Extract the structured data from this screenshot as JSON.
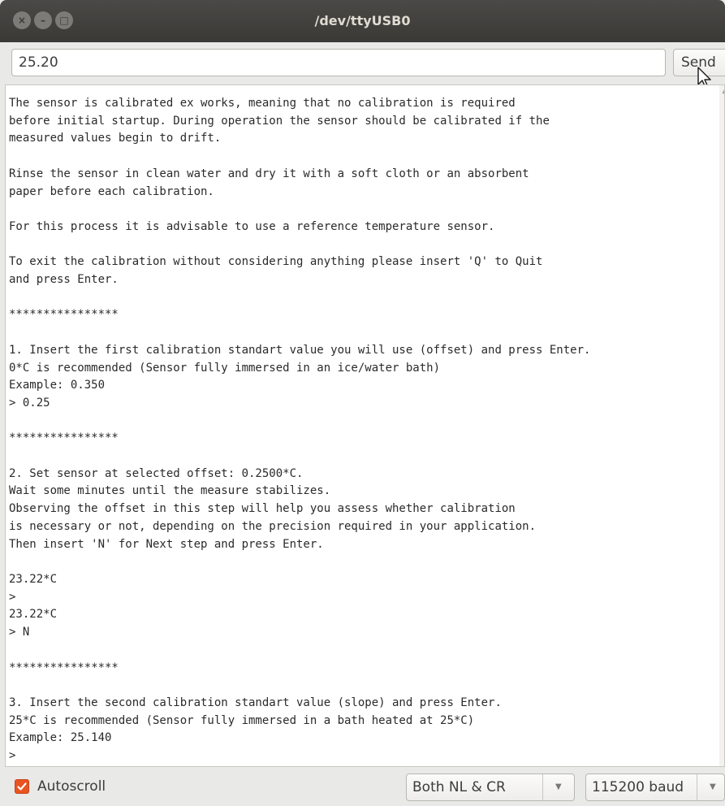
{
  "window": {
    "title": "/dev/ttyUSB0",
    "close_glyph": "×",
    "minimize_glyph": "–",
    "maximize_glyph": "□"
  },
  "input": {
    "value": "25.20",
    "send_label": "Send"
  },
  "output": {
    "text": "The sensor is calibrated ex works, meaning that no calibration is required\nbefore initial startup. During operation the sensor should be calibrated if the\nmeasured values begin to drift.\n\nRinse the sensor in clean water and dry it with a soft cloth or an absorbent\npaper before each calibration.\n\nFor this process it is advisable to use a reference temperature sensor.\n\nTo exit the calibration without considering anything please insert 'Q' to Quit\nand press Enter.\n\n****************\n\n1. Insert the first calibration standart value you will use (offset) and press Enter.\n0*C is recommended (Sensor fully immersed in an ice/water bath)\nExample: 0.350\n> 0.25\n\n****************\n\n2. Set sensor at selected offset: 0.2500*C.\nWait some minutes until the measure stabilizes.\nObserving the offset in this step will help you assess whether calibration\nis necessary or not, depending on the precision required in your application.\nThen insert 'N' for Next step and press Enter.\n\n23.22*C\n>\n23.22*C\n> N\n\n****************\n\n3. Insert the second calibration standart value (slope) and press Enter.\n25*C is recommended (Sensor fully immersed in a bath heated at 25*C)\nExample: 25.140\n>"
  },
  "footer": {
    "autoscroll_label": "Autoscroll",
    "autoscroll_checked": true,
    "line_ending": "Both NL & CR",
    "baud_rate": "115200 baud"
  },
  "colors": {
    "accent": "#e95420",
    "titlebar": "#3e3d39"
  },
  "icons": [
    "close-icon",
    "minimize-icon",
    "maximize-icon",
    "pointer-cursor-icon",
    "checkmark-icon",
    "chevron-down-icon",
    "chevron-up-icon"
  ]
}
